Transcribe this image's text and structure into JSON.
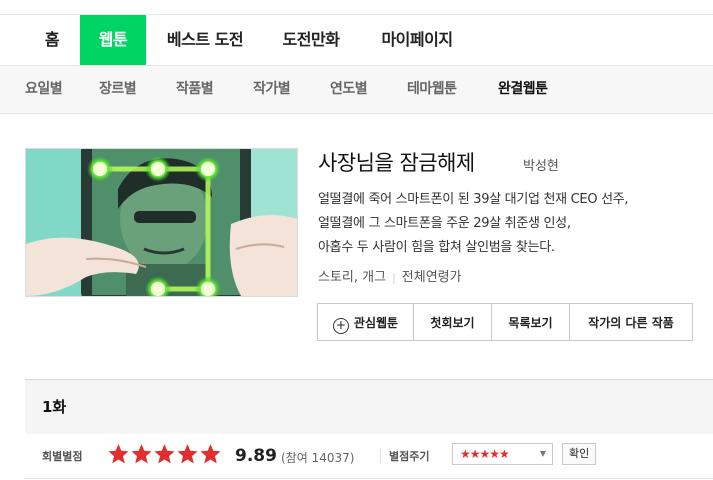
{
  "gnb": {
    "items": [
      {
        "label": "홈",
        "active": false
      },
      {
        "label": "웹툰",
        "active": true
      },
      {
        "label": "베스트 도전",
        "active": false
      },
      {
        "label": "도전만화",
        "active": false
      },
      {
        "label": "마이페이지",
        "active": false
      }
    ]
  },
  "snb": {
    "items": [
      {
        "label": "요일별",
        "active": false
      },
      {
        "label": "장르별",
        "active": false
      },
      {
        "label": "작품별",
        "active": false
      },
      {
        "label": "작가별",
        "active": false
      },
      {
        "label": "연도별",
        "active": false
      },
      {
        "label": "테마웹툰",
        "active": false
      },
      {
        "label": "완결웹툰",
        "active": true
      }
    ]
  },
  "comic": {
    "title": "사장님을 잠금해제",
    "author": "박성현",
    "synopsis": [
      "얼떨결에 죽어 스마트폰이 된 39살 대기업 천재 CEO 선주,",
      "얼떨결에 그 스마트폰을 주운 29살 취준생 인성,",
      "아홉수 두 사람이 힘을 합쳐 살인범을 찾는다."
    ],
    "genre": "스토리, 개그",
    "age": "전체연령가",
    "buttons": {
      "favorite": "관심웹툰",
      "first": "첫회보기",
      "list": "목록보기",
      "other_works": "작가의 다른 작품"
    }
  },
  "episode": {
    "title": "1화"
  },
  "rating": {
    "label": "회별별점",
    "score": "9.89",
    "participants": "(참여 14037)",
    "filled_stars": 5,
    "give_label": "별점주기",
    "selected_stars": "★★★★★",
    "confirm": "확인"
  },
  "colors": {
    "brand_green": "#00d564",
    "star_red": "#e12f2f"
  }
}
